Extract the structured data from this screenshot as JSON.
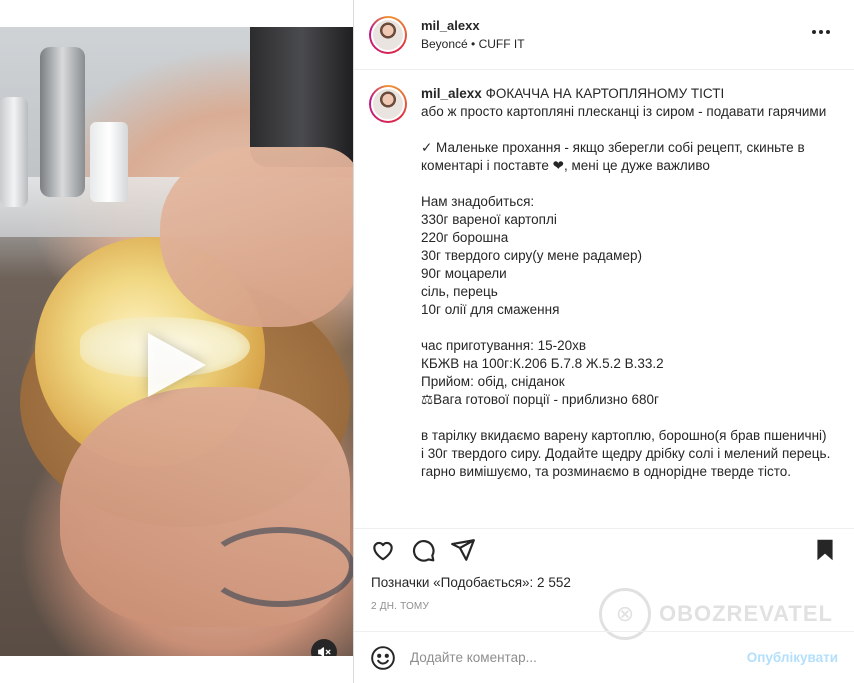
{
  "post": {
    "username": "mil_alexx",
    "audio": "Beyoncé • CUFF IT"
  },
  "caption": {
    "username": "mil_alexx",
    "lines": [
      "ФОКАЧЧА НА КАРТОПЛЯНОМУ ТІСТІ",
      "або ж просто картопляні плесканці із сиром - подавати гарячими",
      "",
      "✓ Маленьке прохання - якщо зберегли собі рецепт, скиньте в коментарі і поставте ❤, мені це дуже важливо",
      "",
      "Нам знадобиться:",
      "330г вареної картоплі",
      "220г борошна",
      "30г твердого сиру(у мене радамер)",
      "90г моцарели",
      "сіль, перець",
      "10г олії для смаження",
      "",
      "час приготування: 15-20хв",
      "КБЖВ на 100г:К.206 Б.7.8 Ж.5.2 В.33.2",
      "Прийом: обід, сніданок",
      "⚖Вага готової порції - приблизно 680г",
      "",
      "в тарілку вкидаємо варену картоплю, борошно(я брав пшеничні) і 30г твердого сиру. Додайте щедру дрібку солі і мелений перець.",
      "гарно вимішуємо, та розминаємо в однорідне тверде тісто."
    ]
  },
  "engagement": {
    "likes_text": "Позначки «Подобається»: 2 552",
    "time_text": "2 ДН. ТОМУ"
  },
  "watermark": {
    "text": "OBOZREVATEL"
  },
  "comment": {
    "placeholder": "Додайте коментар...",
    "post_label": "Опублікувати"
  },
  "icons": {
    "like": "heart-icon",
    "comment": "comment-icon",
    "share": "send-icon",
    "save": "bookmark-icon",
    "emoji": "emoji-icon",
    "more": "more-icon",
    "play": "play-icon",
    "mute": "muted-speaker-icon"
  },
  "colors": {
    "text": "#262626",
    "muted": "#8e8e8e",
    "post_button": "#b2dffc",
    "border": "#dbdbdb"
  }
}
